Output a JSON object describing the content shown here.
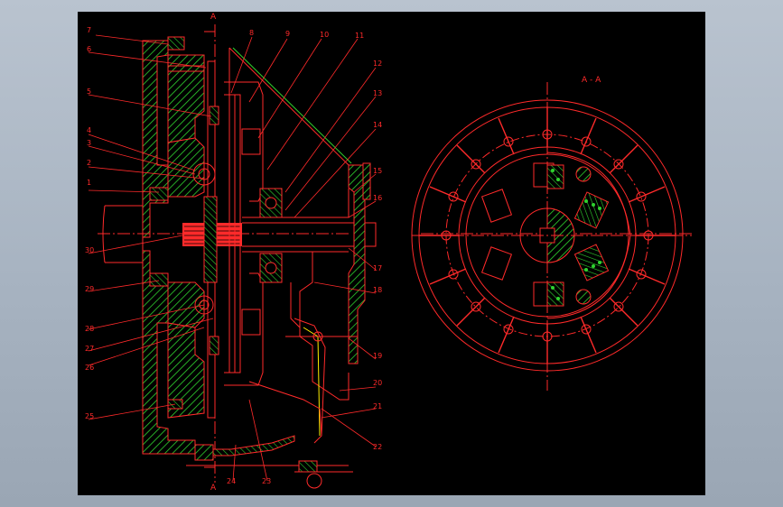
{
  "colors": {
    "outline": "#ff2a2a",
    "hatch": "#2fd22f",
    "accent": "#ffee00",
    "centerline": "#ff2a2a",
    "background": "#000000",
    "frame": "#a9b4c2"
  },
  "section_marks": {
    "top": "A",
    "bottom": "A"
  },
  "view_title": "A - A",
  "part_numbers": {
    "left": [
      "7",
      "6",
      "5",
      "4",
      "3",
      "2",
      "1",
      "30",
      "29",
      "28",
      "27",
      "26",
      "25"
    ],
    "top": [
      "8",
      "9",
      "10",
      "11"
    ],
    "right": [
      "12",
      "13",
      "14",
      "15",
      "16",
      "17",
      "18",
      "19",
      "20",
      "21",
      "22"
    ],
    "bottom": [
      "24",
      "23"
    ]
  }
}
